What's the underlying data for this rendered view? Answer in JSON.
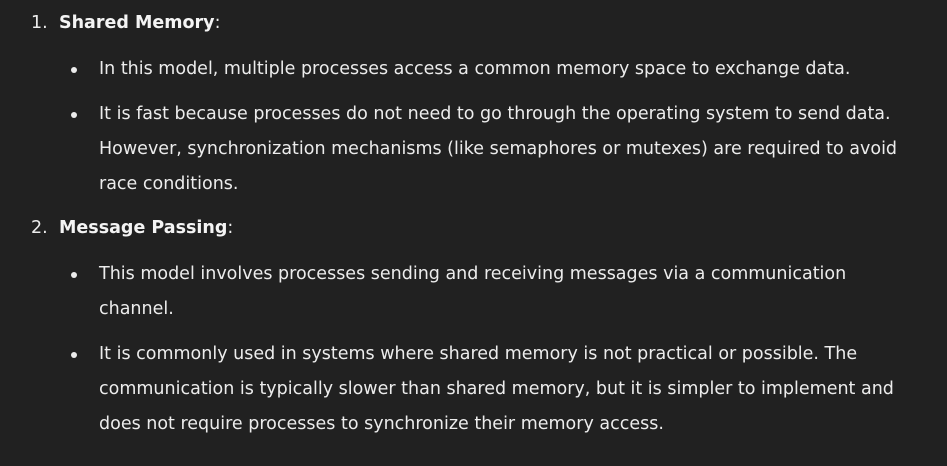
{
  "list": [
    {
      "marker": "1.",
      "title": "Shared Memory",
      "suffix": ":",
      "bullets": [
        "In this model, multiple processes access a common memory space to exchange data.",
        "It is fast because processes do not need to go through the operating system to send data. However, synchronization mechanisms (like semaphores or mutexes) are required to avoid race conditions."
      ]
    },
    {
      "marker": "2.",
      "title": "Message Passing",
      "suffix": ":",
      "bullets": [
        "This model involves processes sending and receiving messages via a communication channel.",
        "It is commonly used in systems where shared memory is not practical or possible. The communication is typically slower than shared memory, but it is simpler to implement and does not require processes to synchronize their memory access."
      ]
    }
  ]
}
